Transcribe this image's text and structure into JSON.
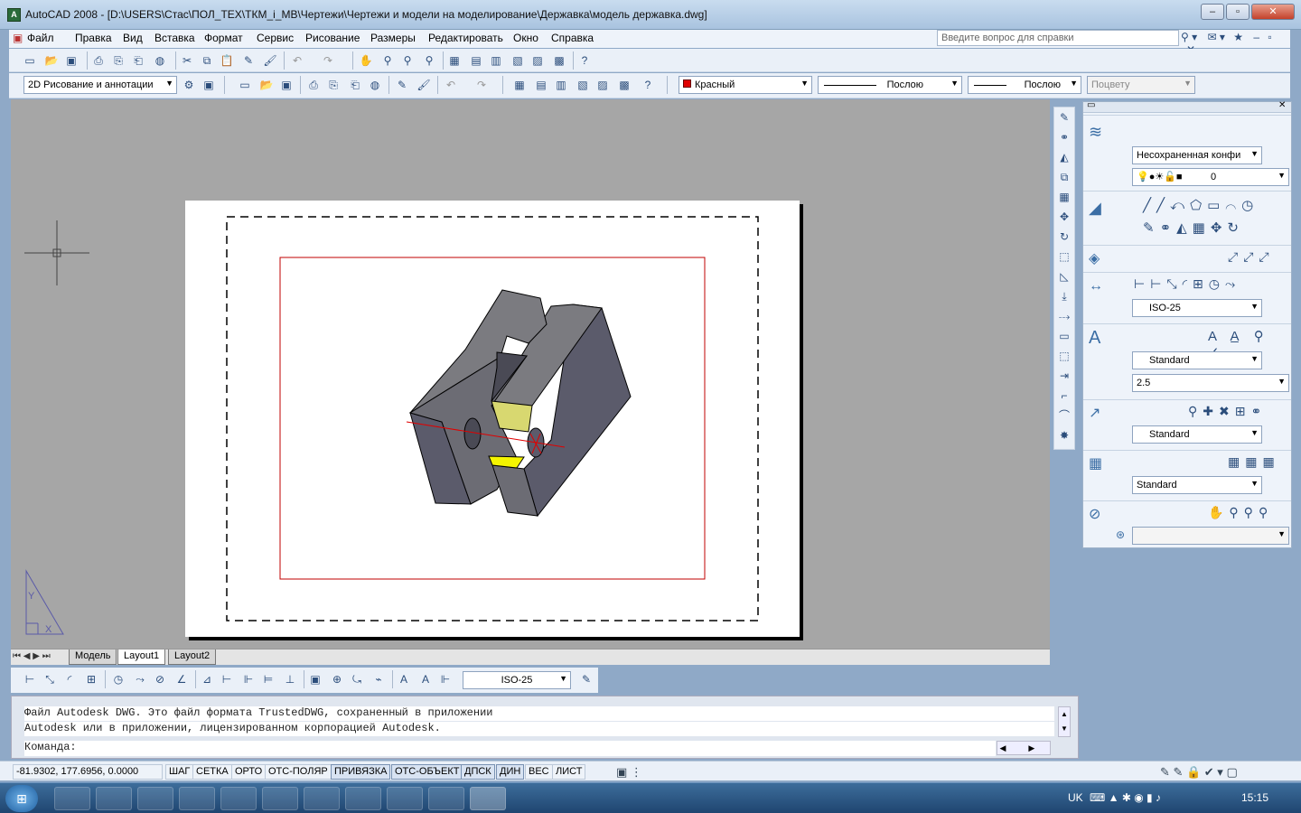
{
  "window": {
    "title": "AutoCAD 2008 - [D:\\USERS\\Стас\\ПОЛ_ТЕХ\\ТКМ_i_МВ\\Чертежи\\Чертежи и модели на моделирование\\Державка\\модель державка.dwg]"
  },
  "menu": [
    "Файл",
    "Правка",
    "Вид",
    "Вставка",
    "Формат",
    "Сервис",
    "Рисование",
    "Размеры",
    "Редактировать",
    "Окно",
    "Справка"
  ],
  "help": {
    "placeholder": "Введите вопрос для справки"
  },
  "workspace": {
    "name": "2D Рисование и аннотации"
  },
  "properties": {
    "color": "Красный",
    "linetype": "Послою",
    "lineweight": "Послою",
    "plotstyle": "Поцвету",
    "color_hex": "#e00000"
  },
  "layout_tabs": [
    "Модель",
    "Layout1",
    "Layout2"
  ],
  "dimstyle": "ISO-25",
  "command": {
    "line1": "Файл Autodesk DWG. Это файл формата TrustedDWG, сохраненный в приложении",
    "line2": "Autodesk или в приложении, лицензированном корпорацией Autodesk.",
    "prompt": "Команда:"
  },
  "status": {
    "coords": "-81.9302, 177.6956, 0.0000",
    "toggles": [
      "ШАГ",
      "СЕТКА",
      "ОРТО",
      "ОТС-ПОЛЯР",
      "ПРИВЯЗКА",
      "ОТС-ОБЪЕКТ",
      "ДПСК",
      "ДИН",
      "ВЕС",
      "ЛИСТ"
    ]
  },
  "palette": {
    "layer_state": "Несохраненная конфи",
    "layer": "0",
    "dim_style": "ISO-25",
    "text_style": "Standard",
    "text_height": "2.5",
    "mleader_style": "Standard",
    "table_style": "Standard"
  },
  "tray": {
    "lang": "UK",
    "time": "15:15"
  },
  "ucs": {
    "y": "Y",
    "x": "X"
  }
}
